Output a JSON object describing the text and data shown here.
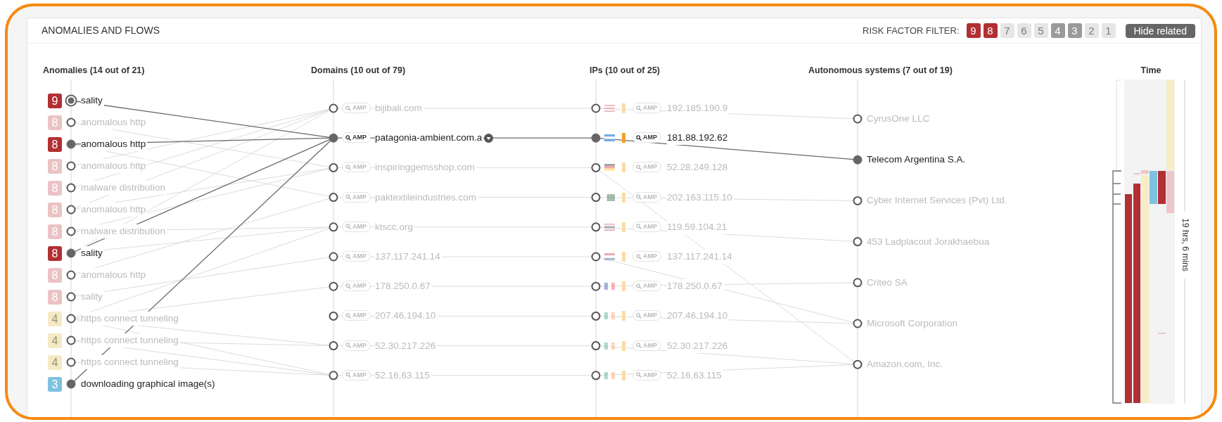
{
  "panel": {
    "title": "ANOMALIES AND FLOWS"
  },
  "risk_filter": {
    "label": "RISK FACTOR FILTER:",
    "levels": [
      {
        "label": "9",
        "selected": true,
        "disabled": false
      },
      {
        "label": "8",
        "selected": true,
        "disabled": false
      },
      {
        "label": "7",
        "selected": false,
        "disabled": true
      },
      {
        "label": "6",
        "selected": false,
        "disabled": true
      },
      {
        "label": "5",
        "selected": false,
        "disabled": true
      },
      {
        "label": "4",
        "selected": false,
        "disabled": false
      },
      {
        "label": "3",
        "selected": false,
        "disabled": false
      },
      {
        "label": "2",
        "selected": false,
        "disabled": true
      },
      {
        "label": "1",
        "selected": false,
        "disabled": true
      }
    ]
  },
  "hide_related_button": {
    "label": "Hide related"
  },
  "anomalies": {
    "header": "Anomalies (14 out of 21)",
    "items": [
      {
        "risk": "9",
        "color": "#b22f33",
        "label": "sality",
        "highlighted": true,
        "selected": true
      },
      {
        "risk": "8",
        "color": "#ebc3c4",
        "label": "anomalous http",
        "highlighted": false,
        "selected": false
      },
      {
        "risk": "8",
        "color": "#b22f33",
        "label": "anomalous http",
        "highlighted": true,
        "selected": false
      },
      {
        "risk": "8",
        "color": "#ebc3c4",
        "label": "anomalous http",
        "highlighted": false,
        "selected": false
      },
      {
        "risk": "8",
        "color": "#ebc3c4",
        "label": "malware distribution",
        "highlighted": false,
        "selected": false
      },
      {
        "risk": "8",
        "color": "#ebc3c4",
        "label": "anomalous http",
        "highlighted": false,
        "selected": false
      },
      {
        "risk": "8",
        "color": "#ebc3c4",
        "label": "malware distribution",
        "highlighted": false,
        "selected": false
      },
      {
        "risk": "8",
        "color": "#b22f33",
        "label": "sality",
        "highlighted": true,
        "selected": false
      },
      {
        "risk": "8",
        "color": "#ebc3c4",
        "label": "anomalous http",
        "highlighted": false,
        "selected": false
      },
      {
        "risk": "8",
        "color": "#ebc3c4",
        "label": "sality",
        "highlighted": false,
        "selected": false
      },
      {
        "risk": "4",
        "color": "#f6eac4",
        "label": "https connect tunneling",
        "highlighted": false,
        "selected": false
      },
      {
        "risk": "4",
        "color": "#f6eac4",
        "label": "https connect tunneling",
        "highlighted": false,
        "selected": false
      },
      {
        "risk": "4",
        "color": "#f6eac4",
        "label": "https connect tunneling",
        "highlighted": false,
        "selected": false
      },
      {
        "risk": "3",
        "color": "#7ec1e0",
        "label": "downloading graphical image(s)",
        "highlighted": true,
        "selected": false
      }
    ]
  },
  "domains": {
    "header": "Domains (10 out of 79)",
    "items": [
      {
        "amp": "AMP",
        "label": "bijibali.com",
        "highlighted": false
      },
      {
        "amp": "AMP",
        "label": "patagonia-ambient.com.a",
        "highlighted": true,
        "has_menu": true
      },
      {
        "amp": "AMP",
        "label": "inspiringgemsshop.com",
        "highlighted": false
      },
      {
        "amp": "AMP",
        "label": "paktextileindustries.com",
        "highlighted": false
      },
      {
        "amp": "AMP",
        "label": "ktscc.org",
        "highlighted": false
      },
      {
        "amp": "AMP",
        "label": "137.117.241.14",
        "highlighted": false
      },
      {
        "amp": "AMP",
        "label": "178.250.0.67",
        "highlighted": false
      },
      {
        "amp": "AMP",
        "label": "207.46.194.10",
        "highlighted": false
      },
      {
        "amp": "AMP",
        "label": "52.30.217.226",
        "highlighted": false
      },
      {
        "amp": "AMP",
        "label": "52.16.63.115",
        "highlighted": false
      }
    ]
  },
  "ips": {
    "header": "IPs (10 out of 25)",
    "items": [
      {
        "amp": "AMP",
        "label": "192.185.190.9",
        "highlighted": false
      },
      {
        "amp": "AMP",
        "label": "181.88.192.62",
        "highlighted": true
      },
      {
        "amp": "AMP",
        "label": "52.28.249.128",
        "highlighted": false
      },
      {
        "amp": "AMP",
        "label": "202.163.115.10",
        "highlighted": false
      },
      {
        "amp": "AMP",
        "label": "119.59.104.21",
        "highlighted": false
      },
      {
        "amp": "AMP",
        "label": "137.117.241.14",
        "highlighted": false
      },
      {
        "amp": "AMP",
        "label": "178.250.0.67",
        "highlighted": false
      },
      {
        "amp": "AMP",
        "label": "207.46.194.10",
        "highlighted": false
      },
      {
        "amp": "AMP",
        "label": "52.30.217.226",
        "highlighted": false
      },
      {
        "amp": "AMP",
        "label": "52.16.63.115",
        "highlighted": false
      }
    ]
  },
  "autonomous_systems": {
    "header": "Autonomous systems (7 out of 19)",
    "items": [
      {
        "label": "CyrusOne LLC",
        "highlighted": false
      },
      {
        "label": "Telecom Argentina S.A.",
        "highlighted": true
      },
      {
        "label": "Cyber Internet Services (Pvt) Ltd.",
        "highlighted": false
      },
      {
        "label": "453 Ladplacout Jorakhaebua",
        "highlighted": false
      },
      {
        "label": "Criteo SA",
        "highlighted": false
      },
      {
        "label": "Microsoft Corporation",
        "highlighted": false
      },
      {
        "label": "Amazon.com, Inc.",
        "highlighted": false
      }
    ]
  },
  "time": {
    "header": "Time",
    "duration": "19 hrs, 6 mins"
  }
}
